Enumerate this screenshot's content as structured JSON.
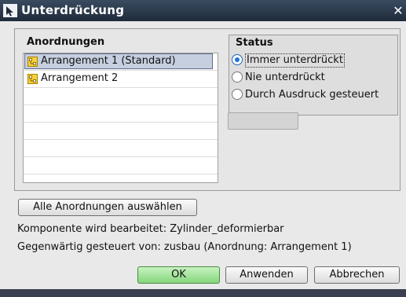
{
  "window": {
    "title": "Unterdrückung",
    "close_glyph": "✕"
  },
  "arrangements": {
    "title": "Anordnungen",
    "items": [
      {
        "label": "Arrangement 1 (Standard)",
        "icon": "arrangement-icon",
        "selected": true
      },
      {
        "label": "Arrangement 2",
        "icon": "arrangement-icon",
        "selected": false
      }
    ]
  },
  "status": {
    "title": "Status",
    "options": [
      {
        "label": "Immer unterdrückt",
        "checked": true
      },
      {
        "label": "Nie unterdrückt",
        "checked": false
      },
      {
        "label": "Durch Ausdruck gesteuert",
        "checked": false
      }
    ],
    "expression_value": ""
  },
  "select_all_label": "Alle Anordnungen auswählen",
  "info": {
    "component_line": "Komponente wird bearbeitet: Zylinder_deformierbar",
    "controlled_line": "Gegenwärtig gesteuert von: zusbau (Anordnung: Arrangement 1)"
  },
  "buttons": {
    "ok": "OK",
    "apply": "Anwenden",
    "cancel": "Abbrechen"
  },
  "colors": {
    "title_bar": "#2b3a4c",
    "selection": "#c6cfe0",
    "ok_button": "#98dc8e",
    "radio_accent": "#2174d6",
    "icon_color": "#e0b000"
  }
}
